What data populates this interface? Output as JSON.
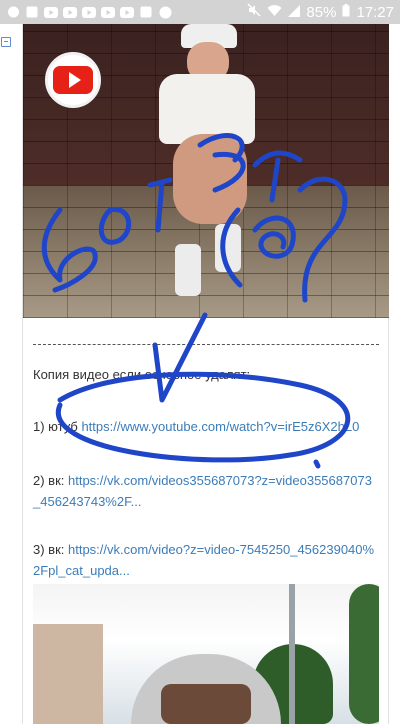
{
  "status_bar": {
    "notifications": [
      "messenger-icon",
      "photo-icon",
      "youtube-icon",
      "youtube-icon",
      "youtube-icon",
      "youtube-icon",
      "youtube-icon",
      "photo-icon",
      "viber-icon"
    ],
    "battery": "85%",
    "time": "17:27"
  },
  "post": {
    "intro": "Копия видео если основное удалят:",
    "link1": {
      "prefix": "1) ютуб ",
      "url": "https://www.youtube.com/watch?v=irE5z6X2hL0"
    },
    "link2": {
      "prefix": "2) вк: ",
      "url": "https://vk.com/videos355687073?z=video355687073_456243743%2F..."
    },
    "link3": {
      "prefix": "3) вк: ",
      "url": "https://vk.com/video?z=video-7545250_456239040%2Fpl_cat_upda..."
    }
  },
  "colors": {
    "annotation": "#1f45c9",
    "link": "#3b7cb8",
    "youtube": "#e62117"
  }
}
